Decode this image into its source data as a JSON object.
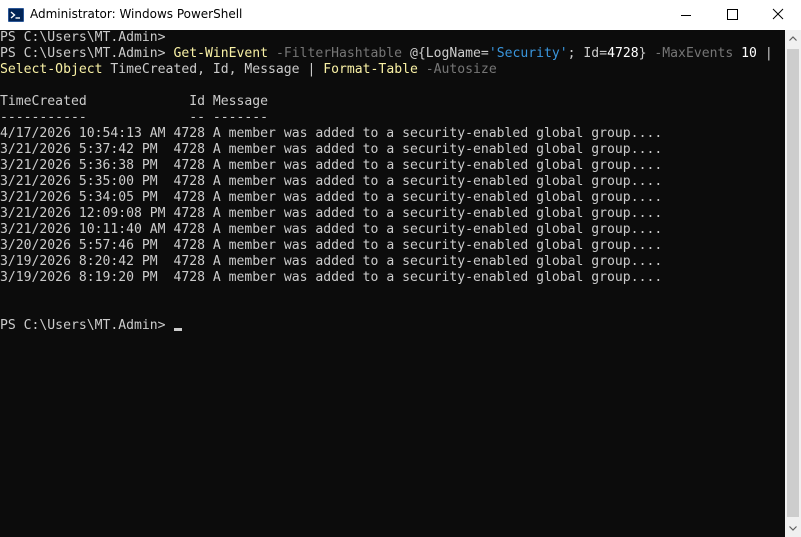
{
  "window": {
    "title": "Administrator: Windows PowerShell",
    "icon": "powershell-icon",
    "controls": [
      "minimize-icon",
      "maximize-icon",
      "close-icon"
    ]
  },
  "console": {
    "prompt_line": "PS C:\\Users\\MT.Admin>",
    "command": {
      "prompt": "PS C:\\Users\\MT.Admin> ",
      "cmdlet1": "Get-WinEvent",
      "param1": "-FilterHashtable",
      "hash_open": "@{LogName=",
      "logname_value": "'Security'",
      "hash_sep": "; Id=",
      "id_value": "4728",
      "hash_close": "}",
      "param2": "-MaxEvents",
      "max_events": "10",
      "pipe1": "|",
      "cmdlet2": "Select-Object",
      "select_args": "TimeCreated, Id, Message",
      "pipe2": "|",
      "cmdlet3": "Format-Table",
      "param3": "-Autosize"
    },
    "table": {
      "header": "TimeCreated             Id Message",
      "underline": "-----------             -- -------",
      "columns": [
        "TimeCreated",
        "Id",
        "Message"
      ],
      "rows": [
        {
          "time": "4/17/2026 10:54:13 AM",
          "id": "4728",
          "message": "A member was added to a security-enabled global group...."
        },
        {
          "time": "3/21/2026 5:37:42 PM",
          "id": "4728",
          "message": "A member was added to a security-enabled global group...."
        },
        {
          "time": "3/21/2026 5:36:38 PM",
          "id": "4728",
          "message": "A member was added to a security-enabled global group...."
        },
        {
          "time": "3/21/2026 5:35:00 PM",
          "id": "4728",
          "message": "A member was added to a security-enabled global group...."
        },
        {
          "time": "3/21/2026 5:34:05 PM",
          "id": "4728",
          "message": "A member was added to a security-enabled global group...."
        },
        {
          "time": "3/21/2026 12:09:08 PM",
          "id": "4728",
          "message": "A member was added to a security-enabled global group...."
        },
        {
          "time": "3/21/2026 10:11:40 AM",
          "id": "4728",
          "message": "A member was added to a security-enabled global group...."
        },
        {
          "time": "3/20/2026 5:57:46 PM",
          "id": "4728",
          "message": "A member was added to a security-enabled global group...."
        },
        {
          "time": "3/19/2026 8:20:42 PM",
          "id": "4728",
          "message": "A member was added to a security-enabled global group...."
        },
        {
          "time": "3/19/2026 8:19:20 PM",
          "id": "4728",
          "message": "A member was added to a security-enabled global group...."
        }
      ]
    },
    "final_prompt": "PS C:\\Users\\MT.Admin> "
  },
  "colors": {
    "background": "#0c0c0c",
    "foreground": "#cccccc",
    "cmdlet": "#f9f1a5",
    "parameter": "#767676",
    "string": "#3a96dd",
    "number": "#ffffff"
  }
}
